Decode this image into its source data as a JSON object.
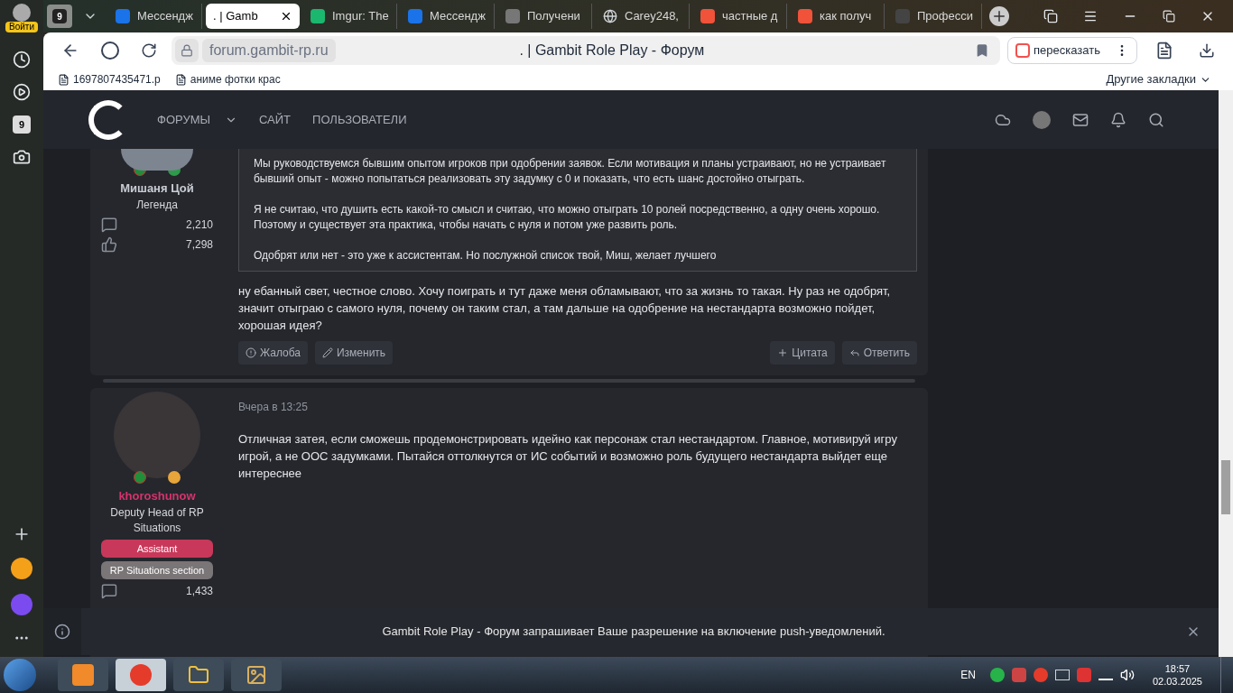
{
  "browser": {
    "profile_label": "Войти",
    "tab_count": "9",
    "tabs": [
      {
        "title": "Мессендж",
        "selected": false
      },
      {
        "title": ". | Gamb",
        "selected": true
      },
      {
        "title": "Imgur: The",
        "selected": false
      },
      {
        "title": "Мессендж",
        "selected": false
      },
      {
        "title": "Получени",
        "selected": false
      },
      {
        "title": "Carey248,",
        "selected": false
      },
      {
        "title": "частные д",
        "selected": false
      },
      {
        "title": "как получ",
        "selected": false
      },
      {
        "title": "Професси",
        "selected": false
      }
    ],
    "address": {
      "domain": "forum.gambit-rp.ru",
      "page_title": ". | Gambit Role Play - Форум"
    },
    "retell_label": "пересказать",
    "bookmarks": [
      "1697807435471.p",
      "аниме фотки крас"
    ],
    "other_bookmarks": "Другие закладки",
    "sidebar_badge": "9"
  },
  "forum": {
    "nav": [
      {
        "label": "ФОРУМЫ",
        "dropdown": true
      },
      {
        "label": "САЙТ",
        "dropdown": false
      },
      {
        "label": "ПОЛЬЗОВАТЕЛИ",
        "dropdown": false
      }
    ],
    "posts": [
      {
        "author": {
          "name": "Мишаня Цой",
          "color": "#c9ccd3"
        },
        "role": "Легенда",
        "stats": [
          {
            "kind": "messages",
            "value": "2,210"
          },
          {
            "kind": "likes",
            "value": "7,298"
          }
        ],
        "quote": [
          "Мы руководствуемся бывшим опытом игроков при одобрении заявок. Если мотивация и планы устраивают, но не устраивает бывший опыт - можно попытаться реализовать эту задумку с 0 и показать, что есть шанс достойно отыграть.",
          "Я не считаю, что душить есть какой-то смысл и считаю, что можно отыграть 10 ролей посредственно, а одну очень хорошо. Поэтому и существует эта практика, чтобы начать с нуля и потом уже развить роль.",
          "Одобрят или нет - это уже к ассистентам. Но послужной список твой, Миш, желает лучшего"
        ],
        "text": "ну ебанный свет, честное слово. Хочу поиграть и тут даже меня обламывают, что за жизнь то такая. Ну раз не одобрят, значит отыграю с самого нуля, почему он таким стал, а там дальше на одобрение на нестандарта возможно пойдет, хорошая идея?",
        "actions": [
          {
            "kind": "report",
            "label": "Жалоба"
          },
          {
            "kind": "edit",
            "label": "Изменить"
          },
          {
            "kind": "quote",
            "label": "Цитата"
          },
          {
            "kind": "reply",
            "label": "Ответить"
          }
        ]
      },
      {
        "date": "Вчера в 13:25",
        "author": {
          "name": "khoroshunow",
          "color": "#d6336c"
        },
        "role": "Deputy Head of RP Situations",
        "badges": [
          {
            "label": "Assistant",
            "color": "#c8385a"
          },
          {
            "label": "RP Situations section",
            "color": "#7a7576"
          }
        ],
        "stats": [
          {
            "kind": "messages",
            "value": "1,433"
          }
        ],
        "text": "Отличная затея, если сможешь продемонстрировать идейно как персонаж стал нестандартом. Главное, мотивируй игру игрой, а не ООС задумками. Пытайся оттолкнутся от ИС событий и возможно роль будущего нестандарта выйдет еще интереснее"
      }
    ]
  },
  "notification": "Gambit Role Play - Форум запрашивает Ваше разрешение на включение push-уведомлений.",
  "taskbar": {
    "language": "EN",
    "time": "18:57",
    "date": "02.03.2025"
  }
}
